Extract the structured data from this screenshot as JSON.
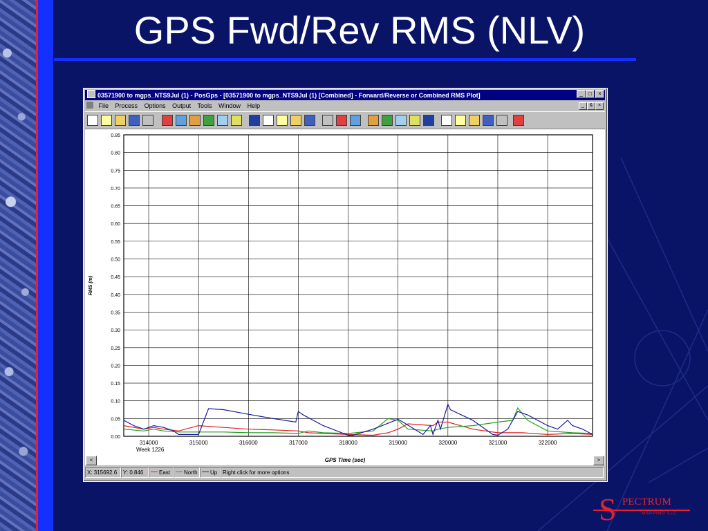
{
  "slide": {
    "title": "GPS Fwd/Rev RMS (NLV)"
  },
  "window": {
    "title": "03571900 to mgps_NTS9Jul (1) - PosGps - [03571900 to mgps_NTS9Jul (1) [Combined] - Forward/Reverse or Combined RMS Plot]",
    "caption_buttons": [
      "_",
      "□",
      "×"
    ],
    "mdi_buttons": [
      "_",
      "&",
      "×"
    ],
    "menu": [
      "File",
      "Process",
      "Options",
      "Output",
      "Tools",
      "Window",
      "Help"
    ],
    "toolbar_icons": [
      "new-file-icon",
      "open-project-icon",
      "open-folder-icon",
      "save-icon",
      "print-icon",
      "gps-data-icon",
      "import-icon",
      "color-wheel-icon",
      "plot-icon",
      "zoom-data-icon",
      "process-icon",
      "satellite-icon",
      "options-icon",
      "folder-open-icon",
      "folder-edit-icon",
      "export-icon",
      "camera-icon",
      "tree-icon",
      "arrow-down-icon",
      "chart-grid-icon",
      "table-icon",
      "save-plot-icon",
      "save-plot-alt-icon",
      "bar-chart-icon",
      "pointer-icon",
      "zoom-in-icon",
      "zoom-out-icon",
      "measure-icon",
      "stop-icon",
      "panel-icon"
    ]
  },
  "statusbar": {
    "x": "X: 315692.6",
    "y": "Y: 0.846",
    "legend": [
      {
        "label": "East",
        "color": "#e02020"
      },
      {
        "label": "North",
        "color": "#20a020"
      },
      {
        "label": "Up",
        "color": "#1a1aa0"
      }
    ],
    "hint": "Right click for more options"
  },
  "scroll": {
    "left": "<",
    "right": ">"
  },
  "chart_data": {
    "type": "line",
    "title": "",
    "xlabel": "GPS Time (sec)",
    "ylabel": "RMS (m)",
    "xlim": [
      313500,
      322900
    ],
    "ylim": [
      0,
      0.85
    ],
    "x_ticks": [
      "314000",
      "315000",
      "316000",
      "317000",
      "318000",
      "319000",
      "320000",
      "321000",
      "322000"
    ],
    "x_tick_values": [
      314000,
      315000,
      316000,
      317000,
      318000,
      319000,
      320000,
      321000,
      322000
    ],
    "x_sublabel": "Week 1226",
    "y_ticks": [
      "0.00",
      "0.05",
      "0.10",
      "0.15",
      "0.20",
      "0.25",
      "0.30",
      "0.35",
      "0.40",
      "0.45",
      "0.50",
      "0.55",
      "0.60",
      "0.65",
      "0.70",
      "0.75",
      "0.80",
      "0.85"
    ],
    "grid": true,
    "series": [
      {
        "name": "East",
        "color": "#e02020",
        "x": [
          313500,
          313900,
          314100,
          314300,
          314600,
          315000,
          315500,
          316000,
          316500,
          317000,
          317200,
          317500,
          318000,
          318500,
          318800,
          319000,
          319200,
          319700,
          319800,
          320000,
          320500,
          321000,
          321500,
          322000,
          322500,
          322900
        ],
        "values": [
          0.03,
          0.02,
          0.025,
          0.02,
          0.015,
          0.03,
          0.025,
          0.02,
          0.018,
          0.015,
          0.01,
          0.008,
          0.005,
          0.003,
          0.01,
          0.02,
          0.035,
          0.03,
          0.04,
          0.04,
          0.02,
          0.01,
          0.01,
          0.005,
          0.008,
          0.005
        ]
      },
      {
        "name": "North",
        "color": "#20a020",
        "x": [
          313500,
          313900,
          314100,
          314300,
          314600,
          315000,
          315500,
          316000,
          316500,
          317000,
          317200,
          317500,
          318000,
          318500,
          318800,
          319000,
          319200,
          319700,
          319800,
          320000,
          320500,
          321000,
          321300,
          321400,
          321600,
          322000,
          322500,
          322900
        ],
        "values": [
          0.02,
          0.015,
          0.02,
          0.015,
          0.012,
          0.012,
          0.012,
          0.01,
          0.01,
          0.008,
          0.015,
          0.01,
          0.008,
          0.015,
          0.05,
          0.045,
          0.02,
          0.015,
          0.02,
          0.025,
          0.03,
          0.04,
          0.045,
          0.08,
          0.045,
          0.015,
          0.01,
          0.008
        ]
      },
      {
        "name": "Up",
        "color": "#1a1aa0",
        "x": [
          313500,
          313700,
          313900,
          314100,
          314300,
          314500,
          314600,
          315000,
          315200,
          315500,
          316000,
          316500,
          316950,
          317000,
          317100,
          317500,
          318000,
          318100,
          318500,
          319000,
          319100,
          319500,
          319650,
          319700,
          319800,
          319850,
          320000,
          320050,
          320500,
          320900,
          321000,
          321200,
          321400,
          321600,
          322000,
          322200,
          322400,
          322500,
          322700,
          322900
        ],
        "values": [
          0.045,
          0.03,
          0.02,
          0.03,
          0.025,
          0.015,
          0.005,
          0.005,
          0.078,
          0.075,
          0.062,
          0.05,
          0.04,
          0.07,
          0.06,
          0.03,
          0.003,
          0.003,
          0.02,
          0.048,
          0.04,
          0.005,
          0.03,
          0.005,
          0.045,
          0.02,
          0.09,
          0.075,
          0.045,
          0.005,
          0.003,
          0.02,
          0.07,
          0.06,
          0.03,
          0.02,
          0.045,
          0.03,
          0.02,
          0.005
        ]
      }
    ]
  },
  "logo": {
    "letter": "S",
    "name": "PECTRUM",
    "sub": "MAPPING LLC"
  }
}
